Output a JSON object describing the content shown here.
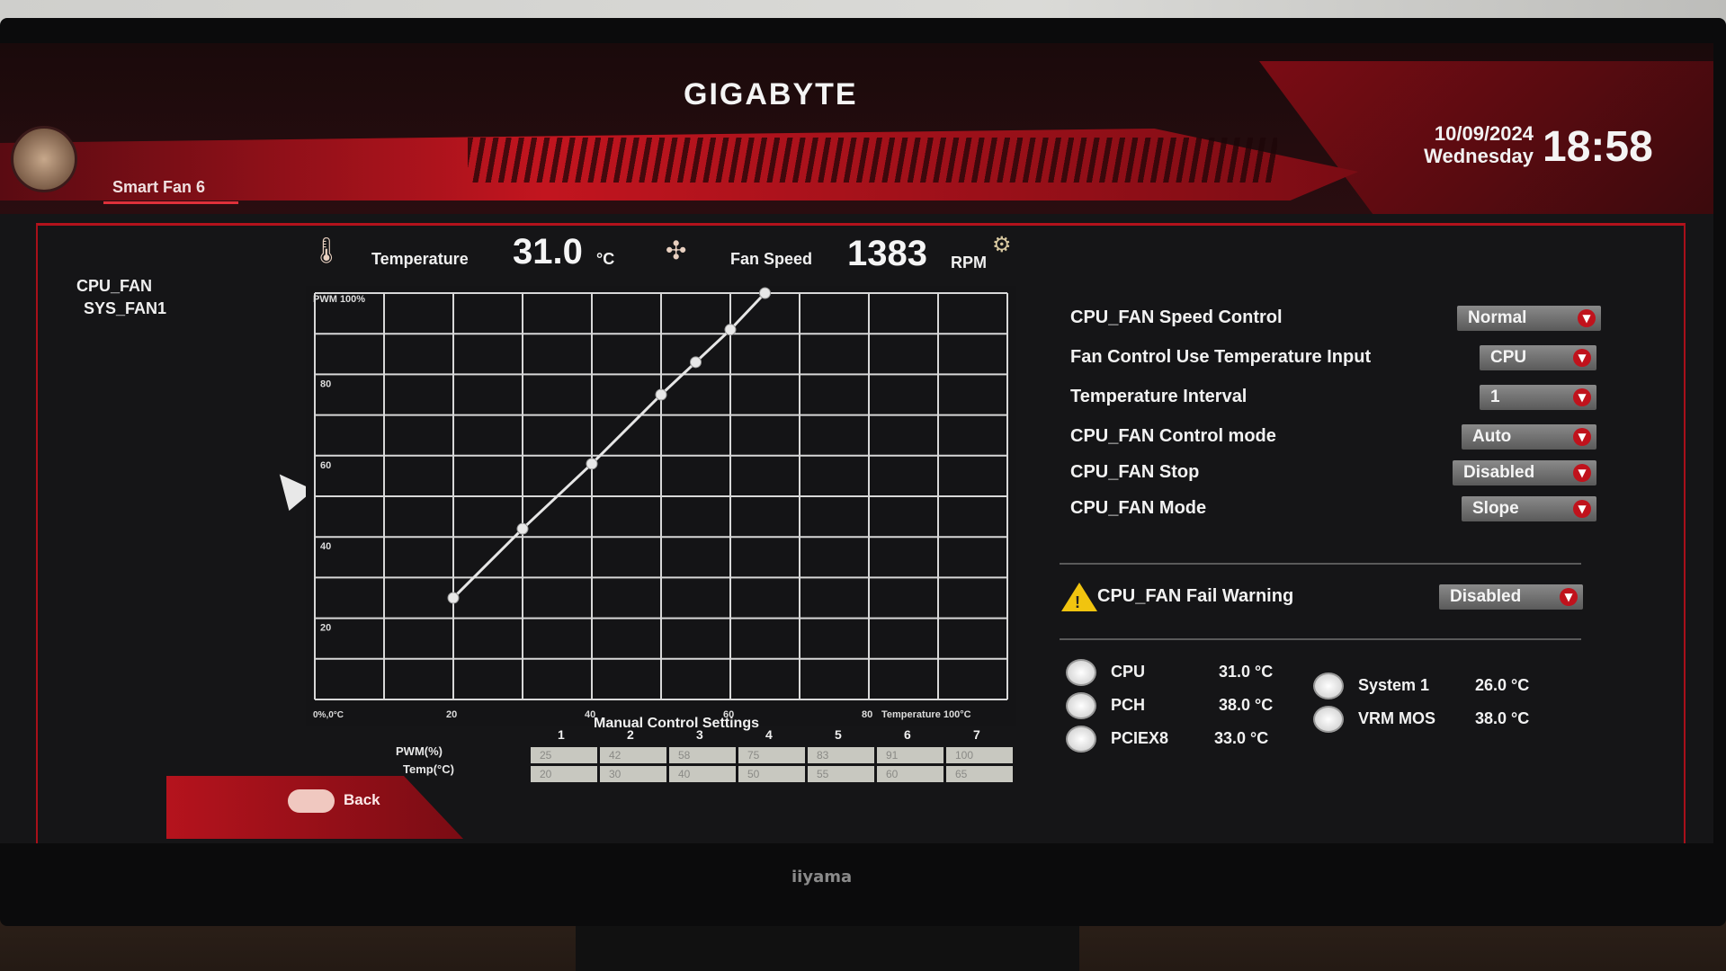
{
  "header": {
    "brand": "GIGABYTE",
    "page_title": "Smart Fan 6",
    "date": "10/09/2024",
    "weekday": "Wednesday",
    "time": "18:58"
  },
  "fans": [
    "CPU_FAN",
    "SYS_FAN1"
  ],
  "readouts": {
    "temperature_label": "Temperature",
    "temperature_value": "31.0",
    "temperature_unit": "°C",
    "fan_speed_label": "Fan Speed",
    "fan_speed_value": "1383",
    "fan_speed_unit": "RPM"
  },
  "chart_data": {
    "type": "line",
    "y_top_label": "PWM 100%",
    "x_right_label": "Temperature 100°C",
    "origin_label": "0%,0°C",
    "x_ticks": [
      "20",
      "40",
      "60",
      "80"
    ],
    "y_ticks": [
      "20",
      "40",
      "60",
      "80"
    ],
    "xlim": [
      0,
      100
    ],
    "ylim": [
      0,
      100
    ],
    "grid": true,
    "series": [
      {
        "x": [
          20,
          30,
          40,
          50,
          55,
          60,
          65
        ],
        "y": [
          25,
          42,
          58,
          75,
          83,
          91,
          100
        ]
      }
    ]
  },
  "manual": {
    "title": "Manual Control Settings",
    "row_pwm": "PWM(%)",
    "row_temp": "Temp(°C)",
    "columns": [
      "1",
      "2",
      "3",
      "4",
      "5",
      "6",
      "7"
    ],
    "pwm": [
      "25",
      "42",
      "58",
      "75",
      "83",
      "91",
      "100"
    ],
    "temp": [
      "20",
      "30",
      "40",
      "50",
      "55",
      "60",
      "65"
    ]
  },
  "back_label": "Back",
  "settings": [
    {
      "label": "CPU_FAN Speed Control",
      "value": "Normal"
    },
    {
      "label": "Fan Control Use Temperature Input",
      "value": "CPU"
    },
    {
      "label": "Temperature Interval",
      "value": "1"
    },
    {
      "label": "CPU_FAN Control mode",
      "value": "Auto"
    },
    {
      "label": "CPU_FAN Stop",
      "value": "Disabled"
    },
    {
      "label": "CPU_FAN Mode",
      "value": "Slope"
    }
  ],
  "fail_warning": {
    "label": "CPU_FAN Fail Warning",
    "value": "Disabled"
  },
  "temps": [
    {
      "name": "CPU",
      "value": "31.0 °C"
    },
    {
      "name": "PCH",
      "value": "38.0 °C"
    },
    {
      "name": "PCIEX8",
      "value": "33.0 °C"
    },
    {
      "name": "System 1",
      "value": "26.0 °C"
    },
    {
      "name": "VRM MOS",
      "value": "38.0 °C"
    }
  ],
  "monitor_brand": "iiyama"
}
